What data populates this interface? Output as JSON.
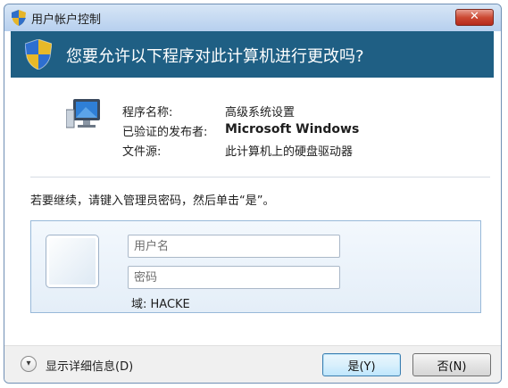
{
  "window": {
    "title": "用户帐户控制",
    "close_label": "✕"
  },
  "banner": {
    "question": "您要允许以下程序对此计算机进行更改吗?"
  },
  "program_info": {
    "name_label": "程序名称:",
    "name_value": "高级系统设置",
    "publisher_label": "已验证的发布者:",
    "publisher_value": "Microsoft Windows",
    "source_label": "文件源:",
    "source_value": "此计算机上的硬盘驱动器"
  },
  "instruction": "若要继续，请键入管理员密码，然后单击“是”。",
  "credentials": {
    "username_placeholder": "用户名",
    "password_placeholder": "密码",
    "domain_label": "域: HACKE"
  },
  "footer": {
    "details_label": "显示详细信息(D)",
    "yes_label": "是(Y)",
    "no_label": "否(N)"
  },
  "colors": {
    "banner": "#1f5f84",
    "titlebar": "#b6cfee",
    "close_button": "#cc4a34"
  },
  "icons": {
    "title": "uac-shield-icon",
    "banner": "uac-shield-icon",
    "program": "computer-icon",
    "details": "chevron-down-icon"
  }
}
